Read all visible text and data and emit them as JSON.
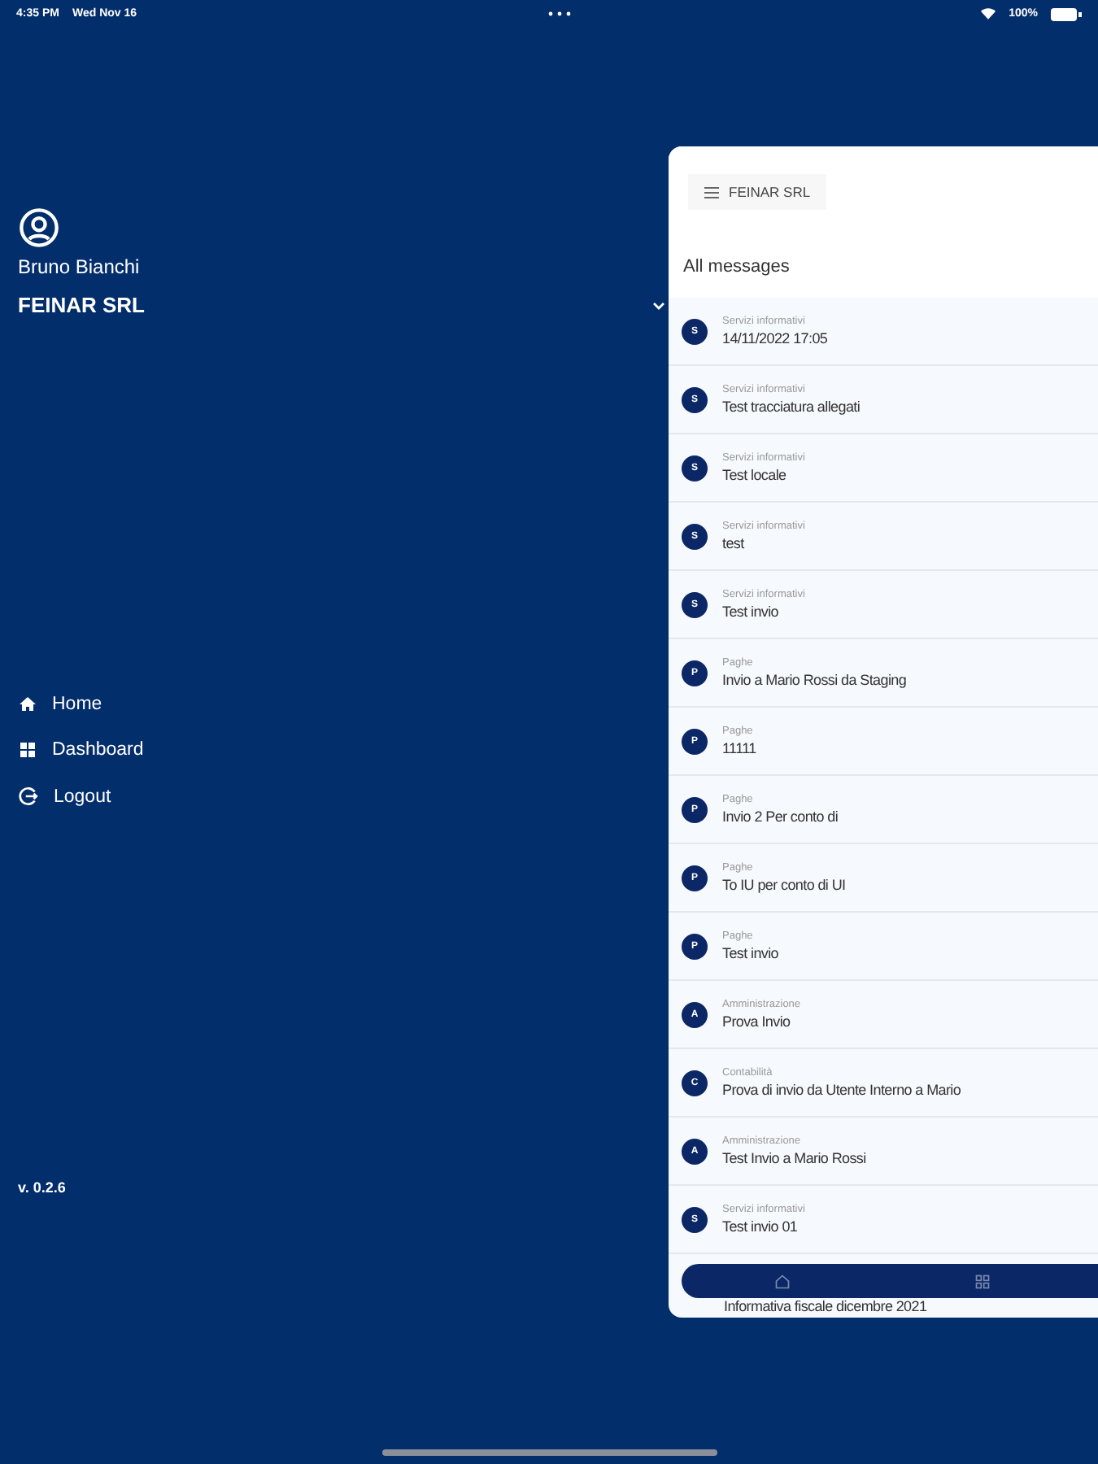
{
  "status_bar": {
    "time": "4:35 PM",
    "date": "Wed Nov 16",
    "battery": "100%"
  },
  "drawer": {
    "user_name": "Bruno Bianchi",
    "company": "FEINAR SRL",
    "menu": [
      {
        "kind": "home",
        "label": "Home"
      },
      {
        "kind": "dashboard",
        "label": "Dashboard"
      },
      {
        "kind": "logout",
        "label": "Logout"
      }
    ],
    "version": "v. 0.2.6"
  },
  "app": {
    "company": "FEINAR SRL",
    "title": "All messages",
    "messages": [
      {
        "initial": "S",
        "category": "Servizi informativi",
        "title": "14/11/2022 17:05"
      },
      {
        "initial": "S",
        "category": "Servizi informativi",
        "title": "Test tracciatura allegati"
      },
      {
        "initial": "S",
        "category": "Servizi informativi",
        "title": "Test locale"
      },
      {
        "initial": "S",
        "category": "Servizi informativi",
        "title": "test"
      },
      {
        "initial": "S",
        "category": "Servizi informativi",
        "title": "Test invio"
      },
      {
        "initial": "P",
        "category": "Paghe",
        "title": "Invio a Mario Rossi da Staging"
      },
      {
        "initial": "P",
        "category": "Paghe",
        "title": "11111"
      },
      {
        "initial": "P",
        "category": "Paghe",
        "title": "Invio 2 Per conto di"
      },
      {
        "initial": "P",
        "category": "Paghe",
        "title": "To IU per conto di UI"
      },
      {
        "initial": "P",
        "category": "Paghe",
        "title": "Test invio"
      },
      {
        "initial": "A",
        "category": "Amministrazione",
        "title": "Prova Invio"
      },
      {
        "initial": "C",
        "category": "Contabilità",
        "title": "Prova di invio da Utente Interno a Mario"
      },
      {
        "initial": "A",
        "category": "Amministrazione",
        "title": "Test Invio a Mario Rossi"
      },
      {
        "initial": "S",
        "category": "Servizi informativi",
        "title": "Test invio 01"
      },
      {
        "title": "Informativa fiscale dicembre 2021"
      }
    ]
  }
}
